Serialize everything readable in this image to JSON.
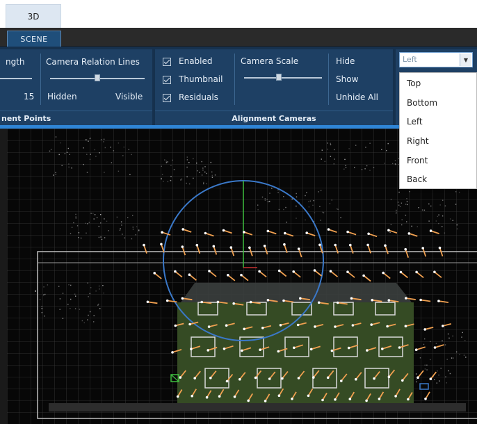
{
  "tabs": {
    "tab_3d": "3D",
    "tab_scene": "SCENE"
  },
  "alignment_points": {
    "length_label_partial": "ngth",
    "length_value": "15",
    "camera_relation_lines_label": "Camera Relation Lines",
    "hidden_label": "Hidden",
    "visible_label": "Visible",
    "group_title_partial": "nent Points",
    "camera_relation_level": 0.5
  },
  "alignment_cameras": {
    "enabled_label": "Enabled",
    "thumbnail_label": "Thumbnail",
    "residuals_label": "Residuals",
    "camera_scale_label": "Camera Scale",
    "hide_label": "Hide",
    "show_label": "Show",
    "unhide_all_label": "Unhide All",
    "group_title": "Alignment Cameras",
    "camera_scale_level": 0.45
  },
  "view_dropdown": {
    "selected": "Left",
    "options": [
      "Top",
      "Bottom",
      "Left",
      "Right",
      "Front",
      "Back"
    ]
  },
  "colors": {
    "ribbon_panel": "#1e4064",
    "accent": "#2f85d6",
    "camera_arrow": "#f0a050",
    "gizmo_circle": "#3a78c8",
    "axis_green": "#3fbf3f",
    "axis_red": "#c83232",
    "vegetation": "#3e5a26"
  }
}
